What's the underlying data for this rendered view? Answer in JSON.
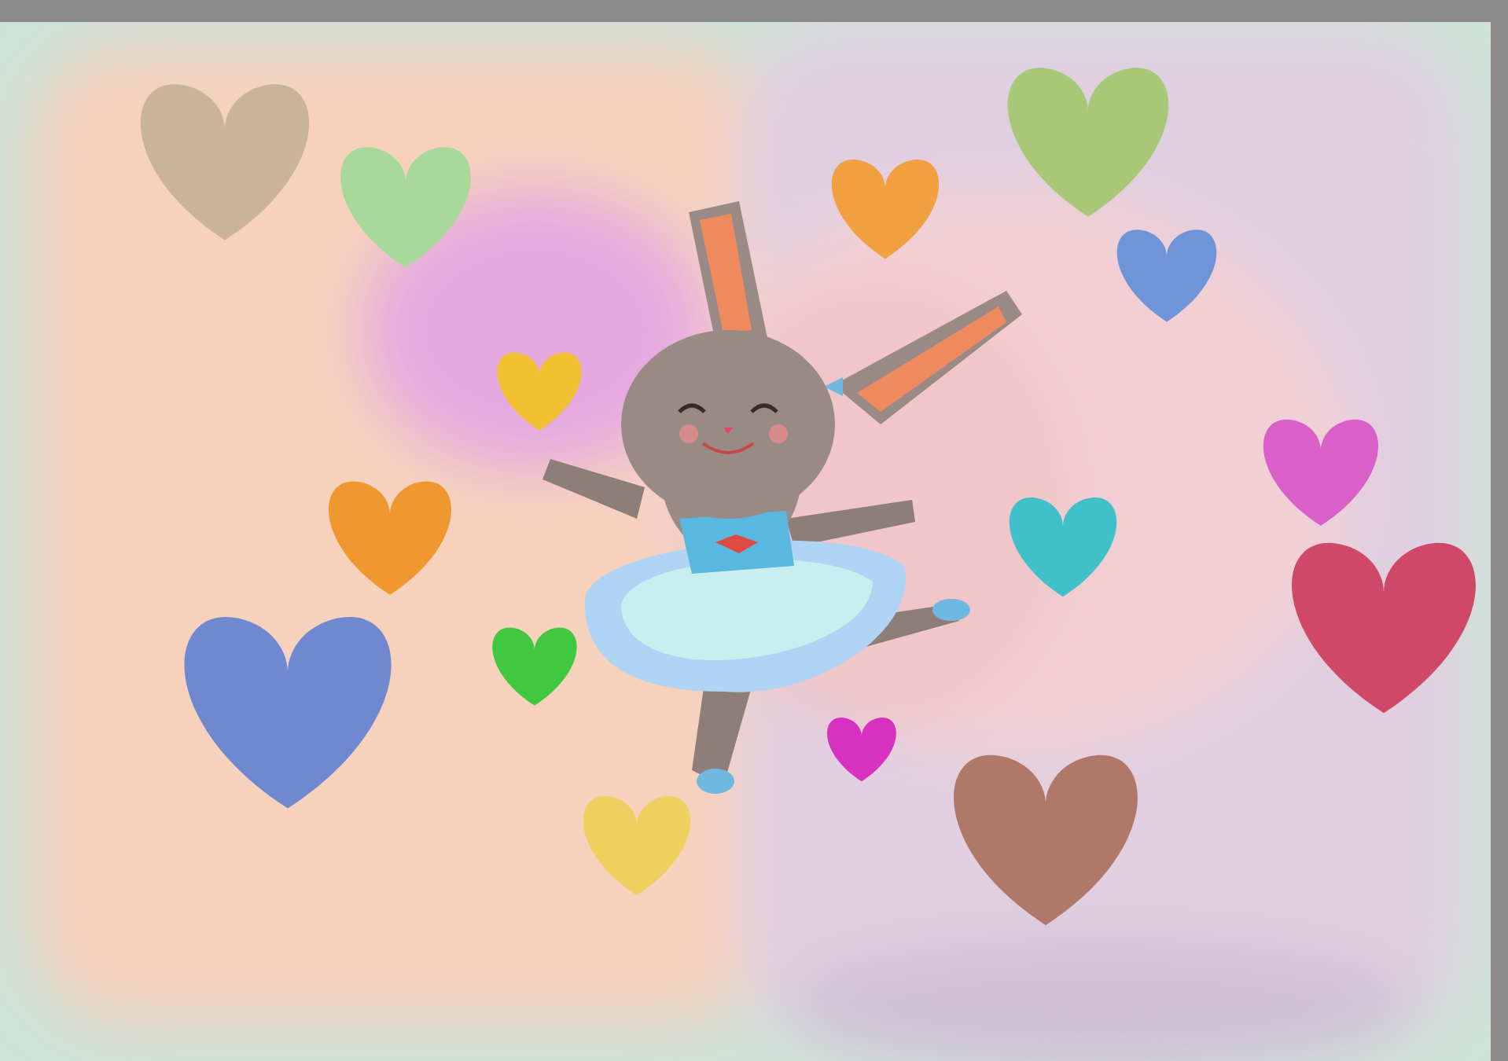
{
  "hearts": [
    {
      "color": "#c9b49a"
    },
    {
      "color": "#a8d89a"
    },
    {
      "color": "#a8c878"
    },
    {
      "color": "#f0a040"
    },
    {
      "color": "#6f95d8"
    },
    {
      "color": "#f0c030"
    },
    {
      "color": "#d860c8"
    },
    {
      "color": "#f09830"
    },
    {
      "color": "#40c0c8"
    },
    {
      "color": "#d04868"
    },
    {
      "color": "#6f88d0"
    },
    {
      "color": "#40c840"
    },
    {
      "color": "#d830c0"
    },
    {
      "color": "#b07868"
    },
    {
      "color": "#f0d060"
    }
  ]
}
